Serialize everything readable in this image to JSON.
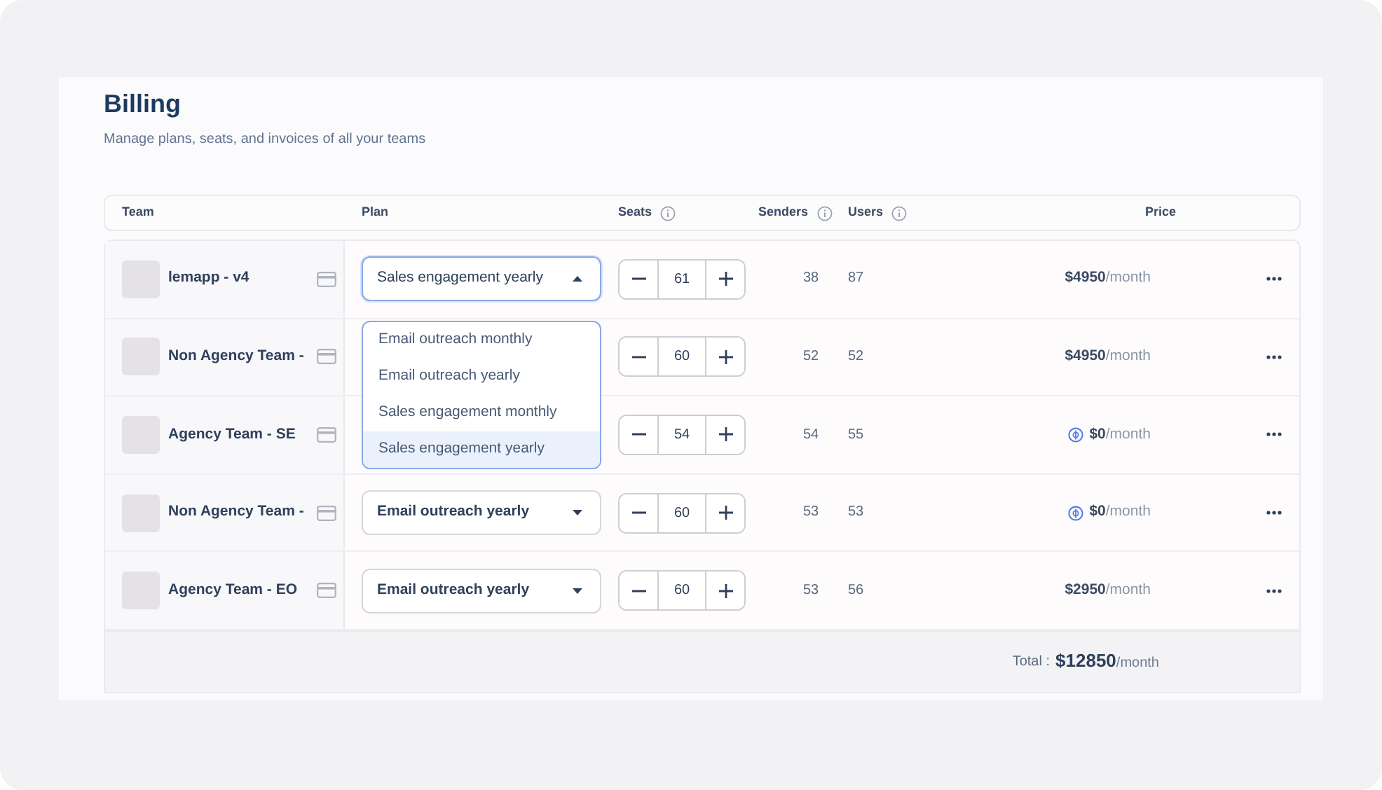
{
  "page": {
    "title": "Billing",
    "subtitle": "Manage plans, seats, and invoices of all your teams"
  },
  "table": {
    "columns": [
      {
        "label": "Team",
        "kind": "plain"
      },
      {
        "label": "Plan",
        "kind": "plain"
      },
      {
        "label": "Seats",
        "kind": "info"
      },
      {
        "label": "Senders",
        "kind": "info"
      },
      {
        "label": "Users",
        "kind": "info"
      },
      {
        "label": "Price",
        "kind": "plain"
      }
    ],
    "rows": [
      {
        "team": "lemapp - v4",
        "plan": {
          "value": "Sales engagement yearly",
          "open": true,
          "options": [
            {
              "label": "Email outreach monthly",
              "selected": false
            },
            {
              "label": "Email outreach yearly",
              "selected": false
            },
            {
              "label": "Sales engagement monthly",
              "selected": false
            },
            {
              "label": "Sales engagement yearly",
              "selected": true
            }
          ]
        },
        "seats": "61",
        "senders": "38",
        "users": "87",
        "amount": "$4950",
        "period": "/month",
        "coin": false
      },
      {
        "team": "Non Agency Team -",
        "seats": "60",
        "senders": "52",
        "users": "52",
        "amount": "$4950",
        "period": "/month",
        "coin": false
      },
      {
        "team": "Agency Team - SE",
        "seats": "54",
        "senders": "54",
        "users": "55",
        "amount": "$0",
        "period": "/month",
        "coin": true
      },
      {
        "team": "Non Agency Team -",
        "plan": {
          "value": "Email outreach yearly",
          "open": false
        },
        "seats": "60",
        "senders": "53",
        "users": "53",
        "amount": "$0",
        "period": "/month",
        "coin": true
      },
      {
        "team": "Agency Team - EO",
        "plan": {
          "value": "Email outreach yearly",
          "open": false
        },
        "seats": "60",
        "senders": "53",
        "users": "56",
        "amount": "$2950",
        "period": "/month",
        "coin": false
      }
    ],
    "total": {
      "label": "Total :",
      "amount": "$12850",
      "period": "/month"
    }
  }
}
